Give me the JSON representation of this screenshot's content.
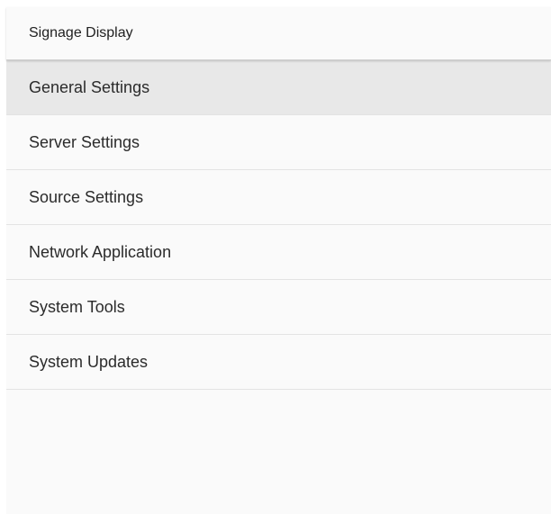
{
  "app_bar": {
    "title": "Signage Display"
  },
  "menu": {
    "selected_index": 0,
    "items": [
      {
        "label": "General Settings"
      },
      {
        "label": "Server Settings"
      },
      {
        "label": "Source Settings"
      },
      {
        "label": "Network Application"
      },
      {
        "label": "System Tools"
      },
      {
        "label": "System Updates"
      }
    ]
  },
  "colors": {
    "background": "#fafafa",
    "selected_item": "#e8e8e8",
    "divider": "#e3e3e3",
    "text": "#2b2b2b"
  }
}
